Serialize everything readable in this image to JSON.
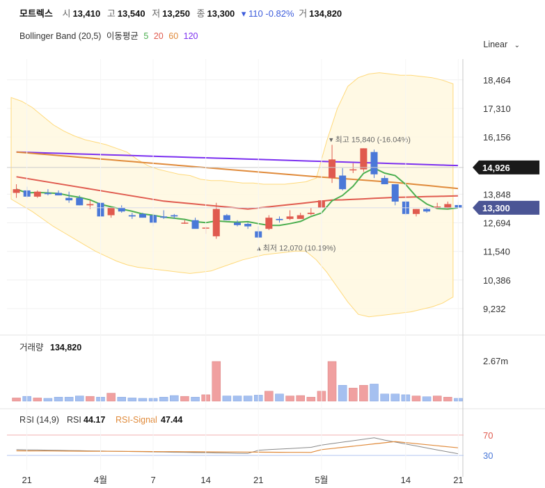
{
  "header": {
    "name": "모트렉스",
    "open_label": "시",
    "open": "13,410",
    "high_label": "고",
    "high": "13,540",
    "low_label": "저",
    "low": "13,250",
    "close_label": "종",
    "close": "13,300",
    "change": "▾ 110 -0.82%",
    "volume_label": "거",
    "volume": "134,820"
  },
  "indicators": {
    "bb_label": "Bollinger Band (20,5)",
    "ma_label": "이동평균",
    "ma_periods": [
      "5",
      "20",
      "60",
      "120"
    ],
    "ma_colors": [
      "#4caf50",
      "#e05a4e",
      "#e08a3a",
      "#7b2ff0"
    ]
  },
  "scale_button": "Linear",
  "chart_data": {
    "type": "candlestick",
    "price_axis_ticks": [
      "18,464",
      "17,310",
      "16,156",
      "13,848",
      "12,694",
      "11,540",
      "10,386",
      "9,232"
    ],
    "price_range": [
      8500,
      19300
    ],
    "date_labels": [
      "21",
      "4월",
      "7",
      "14",
      "21",
      "5월",
      "14",
      "21"
    ],
    "ohlc": [
      [
        13900,
        14250,
        13700,
        14050
      ],
      [
        14000,
        14150,
        13700,
        13750
      ],
      [
        13750,
        14000,
        13700,
        13950
      ],
      [
        13900,
        14050,
        13800,
        13850
      ],
      [
        13900,
        14000,
        13800,
        13800
      ],
      [
        13700,
        13950,
        13500,
        13600
      ],
      [
        13700,
        13800,
        13400,
        13400
      ],
      [
        13400,
        13600,
        13250,
        13450
      ],
      [
        13500,
        13600,
        12900,
        12950
      ],
      [
        13000,
        13300,
        12900,
        13300
      ],
      [
        13300,
        13400,
        13100,
        13150
      ],
      [
        13000,
        13100,
        12850,
        12950
      ],
      [
        13050,
        13100,
        12900,
        12900
      ],
      [
        13000,
        13100,
        12550,
        12700
      ],
      [
        12950,
        13200,
        12850,
        12900
      ],
      [
        13000,
        13050,
        12850,
        12950
      ],
      [
        12700,
        12800,
        12650,
        12700
      ],
      [
        12800,
        12900,
        12500,
        12450
      ],
      [
        12500,
        12550,
        12250,
        12500
      ],
      [
        12150,
        13500,
        12050,
        13250
      ],
      [
        13000,
        13050,
        12800,
        12800
      ],
      [
        12700,
        12800,
        12550,
        12600
      ],
      [
        12650,
        12700,
        12450,
        12550
      ],
      [
        12350,
        12550,
        12070,
        12100
      ],
      [
        12450,
        13000,
        12400,
        12900
      ],
      [
        12850,
        12950,
        12700,
        12800
      ],
      [
        12850,
        13200,
        12800,
        12950
      ],
      [
        12850,
        13100,
        12850,
        13000
      ],
      [
        13050,
        13300,
        13000,
        13100
      ],
      [
        13300,
        13600,
        13300,
        13600
      ],
      [
        14500,
        15840,
        14300,
        15250
      ],
      [
        14600,
        14900,
        14000,
        14050
      ],
      [
        14850,
        15100,
        14700,
        14850
      ],
      [
        14850,
        15700,
        14750,
        15700
      ],
      [
        15550,
        15650,
        14500,
        14650
      ],
      [
        14500,
        14600,
        14250,
        14250
      ],
      [
        14250,
        14250,
        13400,
        13550
      ],
      [
        13550,
        13600,
        13000,
        13050
      ],
      [
        13050,
        13250,
        12950,
        13250
      ],
      [
        13250,
        13300,
        13100,
        13150
      ],
      [
        13300,
        13500,
        13250,
        13350
      ],
      [
        13300,
        13550,
        13250,
        13450
      ],
      [
        13410,
        13540,
        13250,
        13300
      ]
    ],
    "volume_ticks": [
      "2.67m"
    ],
    "volume_label": "거래량",
    "volume_value": "134,820",
    "volume": [
      0.08,
      0.12,
      0.08,
      0.07,
      0.1,
      0.1,
      0.13,
      0.12,
      0.1,
      0.2,
      0.1,
      0.08,
      0.07,
      0.07,
      0.1,
      0.14,
      0.12,
      0.1,
      0.16,
      1.0,
      0.13,
      0.13,
      0.13,
      0.15,
      0.25,
      0.18,
      0.13,
      0.14,
      0.1,
      0.25,
      1.0,
      0.4,
      0.33,
      0.4,
      0.43,
      0.18,
      0.18,
      0.16,
      0.13,
      0.11,
      0.13,
      0.1,
      0.07
    ],
    "lows_annotation": "최저 12,070 (10.19%)",
    "highs_annotation": "최고 15,840 (-16.04%)",
    "price_tags": [
      {
        "label": "14,926",
        "color": "#1a1a1a"
      },
      {
        "label": "13,300",
        "color": "#4b5595"
      }
    ],
    "rsi": {
      "label": "RSI (14,9)",
      "rsi_label": "RSI",
      "rsi_value": "44.17",
      "signal_label": "RSI-Signal",
      "signal_value": "47.44",
      "levels": [
        "70",
        "30"
      ]
    }
  }
}
